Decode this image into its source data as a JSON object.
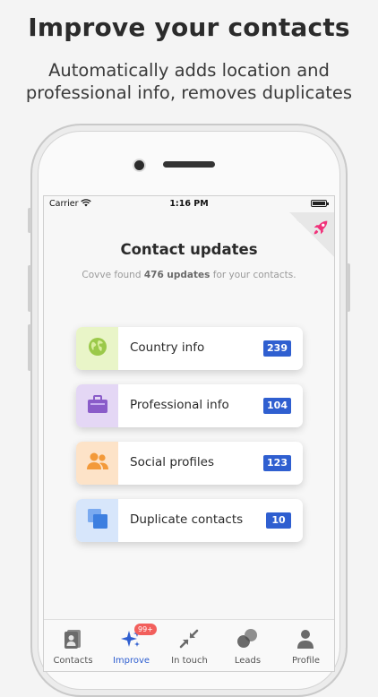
{
  "promo": {
    "headline": "Improve your contacts",
    "subheadline_line1": "Automatically adds location and",
    "subheadline_line2": "professional info, removes duplicates"
  },
  "status_bar": {
    "carrier": "Carrier",
    "time": "1:16 PM"
  },
  "screen": {
    "title": "Contact updates",
    "summary_prefix": "Covve found ",
    "summary_count": "476 updates",
    "summary_suffix": " for your contacts."
  },
  "update_cards": [
    {
      "label": "Country info",
      "count": "239",
      "icon": "globe-icon",
      "icon_bg": "#e9f5c8",
      "icon_color": "#9bc94a"
    },
    {
      "label": "Professional info",
      "count": "104",
      "icon": "briefcase-icon",
      "icon_bg": "#e4d7f5",
      "icon_color": "#8a5cc9"
    },
    {
      "label": "Social profiles",
      "count": "123",
      "icon": "people-icon",
      "icon_bg": "#fde3c8",
      "icon_color": "#f39a3a"
    },
    {
      "label": "Duplicate contacts",
      "count": "10",
      "icon": "duplicate-icon",
      "icon_bg": "#d7e6fb",
      "icon_color": "#3d7fe0"
    }
  ],
  "tabs": [
    {
      "label": "Contacts",
      "icon": "contacts-icon",
      "active": false
    },
    {
      "label": "Improve",
      "icon": "sparkle-icon",
      "active": true,
      "badge": "99+"
    },
    {
      "label": "In touch",
      "icon": "arrows-inward-icon",
      "active": false
    },
    {
      "label": "Leads",
      "icon": "leads-icon",
      "active": false
    },
    {
      "label": "Profile",
      "icon": "person-icon",
      "active": false
    }
  ],
  "colors": {
    "accent": "#2f5fd0",
    "rocket": "#f0327a",
    "badge_red": "#f25f5c"
  }
}
